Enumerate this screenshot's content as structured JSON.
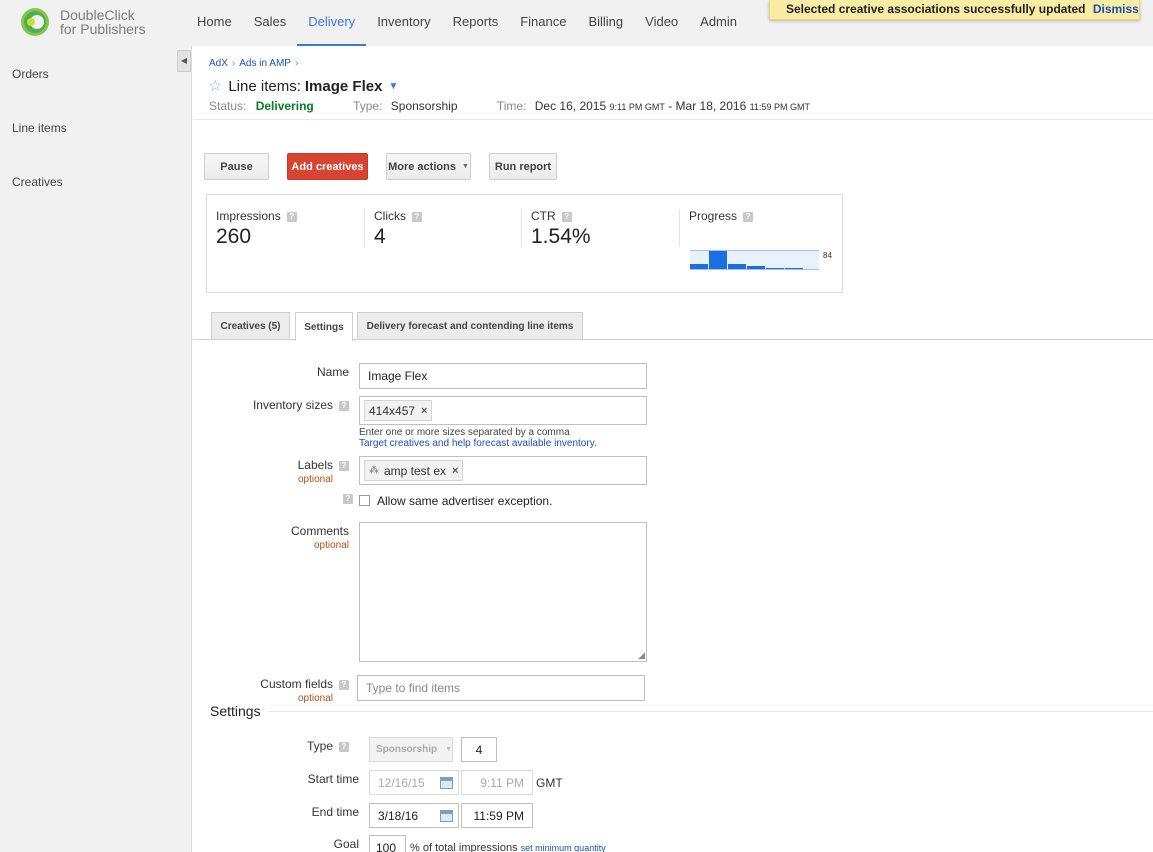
{
  "app": {
    "logo_line1": "DoubleClick",
    "logo_line2": "for Publishers"
  },
  "nav": {
    "items": [
      "Home",
      "Sales",
      "Delivery",
      "Inventory",
      "Reports",
      "Finance",
      "Billing",
      "Video",
      "Admin"
    ],
    "active": "Delivery"
  },
  "toast": {
    "message": "Selected creative associations successfully updated",
    "dismiss": "Dismiss"
  },
  "sidebar": {
    "items": [
      "Orders",
      "Line items",
      "Creatives"
    ]
  },
  "breadcrumb": {
    "items": [
      "AdX",
      "Ads in AMP"
    ],
    "separator": "›"
  },
  "header": {
    "title_prefix": "Line items:",
    "title_name": "Image Flex",
    "status_label": "Status:",
    "status_value": "Delivering",
    "type_label": "Type:",
    "type_value": "Sponsorship",
    "time_label": "Time:",
    "start_date": "Dec 16, 2015",
    "start_time": "9:11 PM GMT",
    "dash": "-",
    "end_date": "Mar 18, 2016",
    "end_time": "11:59 PM GMT"
  },
  "toolbar": {
    "pause": "Pause",
    "add_creatives": "Add creatives",
    "more_actions": "More actions",
    "run_report": "Run report"
  },
  "stats": {
    "impressions_label": "Impressions",
    "impressions_value": "260",
    "clicks_label": "Clicks",
    "clicks_value": "4",
    "ctr_label": "CTR",
    "ctr_value": "1.54%",
    "progress_label": "Progress",
    "progress_max": "84",
    "progress_bars": [
      0.25,
      1.0,
      0.28,
      0.14,
      0.05,
      0.02
    ]
  },
  "tabs": {
    "creatives": "Creatives (5)",
    "settings": "Settings",
    "forecast": "Delivery forecast and contending line items"
  },
  "form": {
    "name_label": "Name",
    "name_value": "Image Flex",
    "sizes_label": "Inventory sizes",
    "sizes_chip": "414x457",
    "sizes_hint": "Enter one or more sizes separated by a comma",
    "sizes_link": "Target creatives and help forecast available inventory.",
    "labels_label": "Labels",
    "optional": "optional",
    "labels_chip": "amp test ex",
    "exception_label": "Allow same advertiser exception.",
    "comments_label": "Comments",
    "custom_label": "Custom fields",
    "custom_placeholder": "Type to find items",
    "chip_remove": "×",
    "help": "?"
  },
  "settings": {
    "section_title": "Settings",
    "type_label": "Type",
    "type_value": "Sponsorship",
    "priority_value": "4",
    "start_label": "Start time",
    "start_date": "12/16/15",
    "start_time": "9:11 PM",
    "tz": "GMT",
    "end_label": "End time",
    "end_date": "3/18/16",
    "end_time": "11:59 PM",
    "goal_label": "Goal",
    "goal_value": "100",
    "goal_unit": "% of total impressions",
    "goal_link": "set minimum quantity"
  },
  "colors": {
    "accent": "#3b78e7",
    "primary_button": "#d74431",
    "status_green": "#0a7d2c",
    "toast_bg": "#f9eda6",
    "link": "#1a4fb8"
  }
}
